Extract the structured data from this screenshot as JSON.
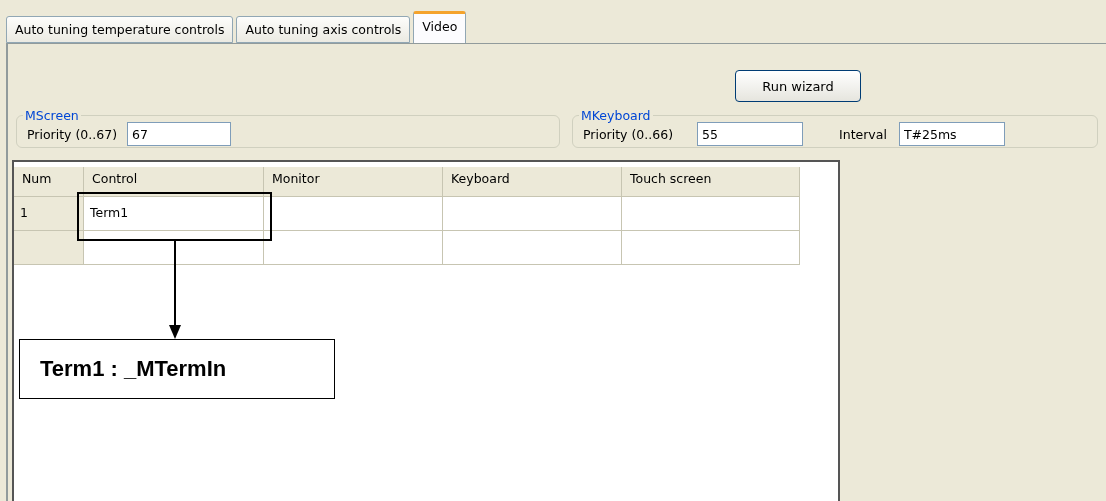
{
  "tabs": [
    {
      "label": "Auto tuning temperature controls",
      "selected": false
    },
    {
      "label": "Auto tuning axis controls",
      "selected": false
    },
    {
      "label": "Video",
      "selected": true
    }
  ],
  "run_wizard_button": "Run wizard",
  "mscreen": {
    "title": "MScreen",
    "priority_label": "Priority (0..67)",
    "priority_value": "67"
  },
  "mkeyboard": {
    "title": "MKeyboard",
    "priority_label": "Priority (0..66)",
    "priority_value": "55",
    "interval_label": "Interval",
    "interval_value": "T#25ms"
  },
  "table": {
    "columns": [
      "Num",
      "Control",
      "Monitor",
      "Keyboard",
      "Touch screen"
    ],
    "rows": [
      [
        "1",
        "Term1",
        "",
        "",
        ""
      ],
      [
        "",
        "",
        "",
        "",
        ""
      ]
    ]
  },
  "annotation": {
    "label": "Term1 : _MTermIn"
  }
}
